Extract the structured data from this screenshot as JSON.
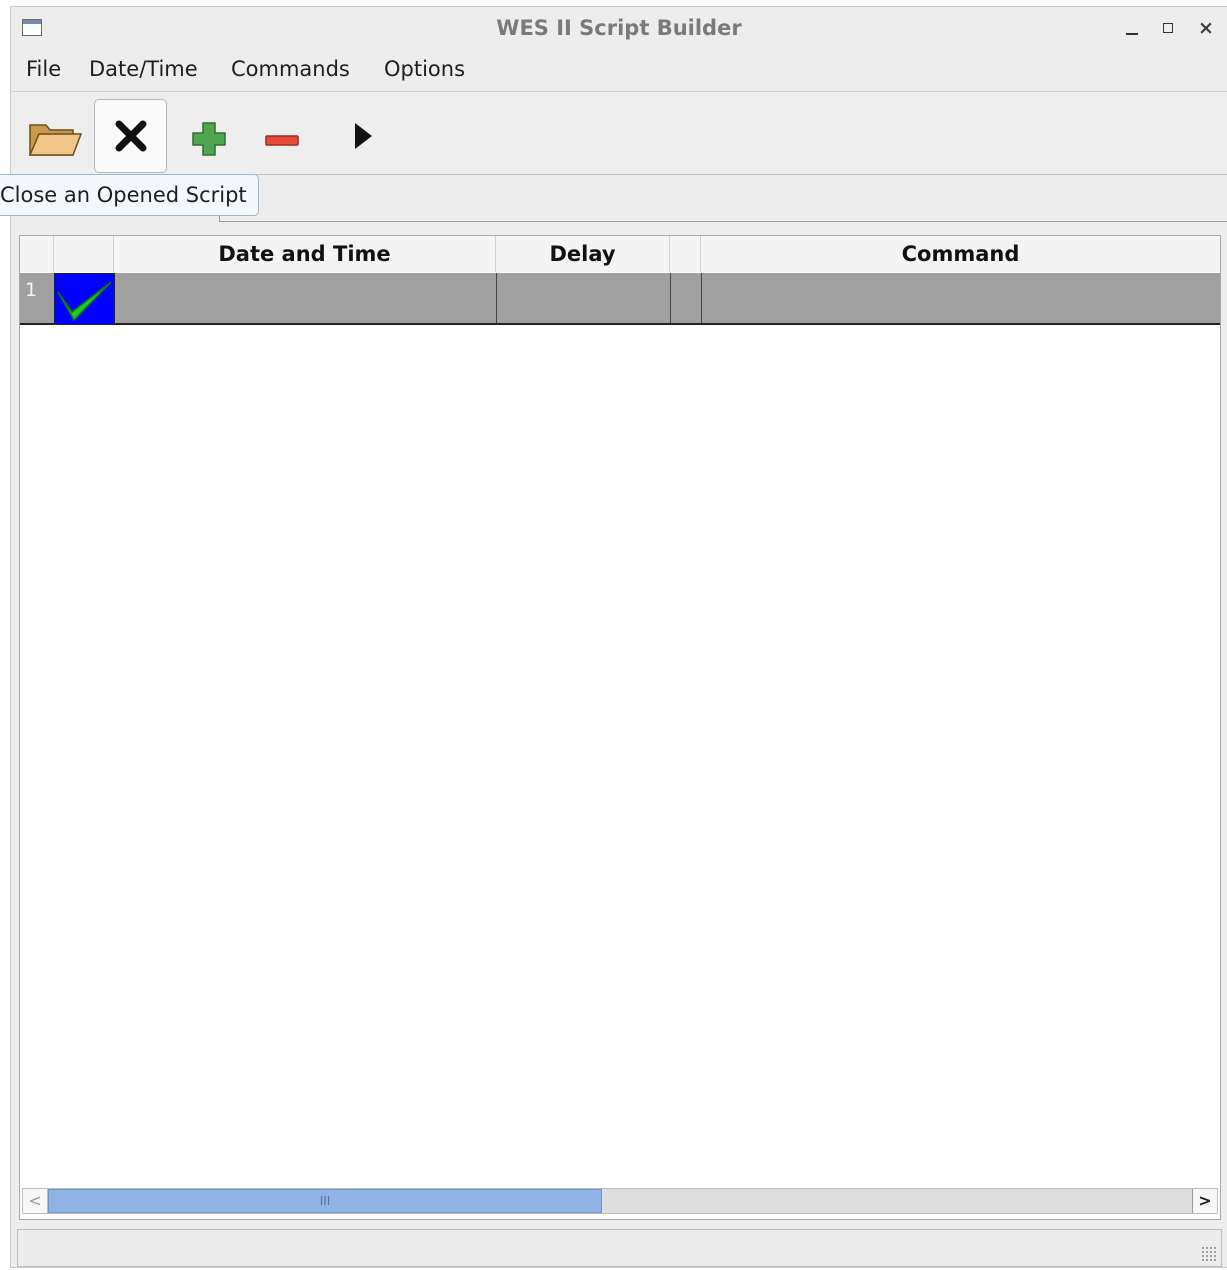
{
  "window": {
    "title": "WES II Script Builder",
    "icon": "window-icon",
    "controls": {
      "minimize": "minimize-icon",
      "maximize": "maximize-icon",
      "close": "×"
    }
  },
  "menubar": {
    "items": [
      {
        "label": "File"
      },
      {
        "label": "Date/Time"
      },
      {
        "label": "Commands"
      },
      {
        "label": "Options"
      }
    ]
  },
  "toolbar": {
    "buttons": [
      {
        "name": "open-script",
        "icon": "folder-open-icon"
      },
      {
        "name": "close-script",
        "icon": "close-x-icon",
        "state": "hovered"
      },
      {
        "name": "add-command",
        "icon": "plus-icon"
      },
      {
        "name": "remove-command",
        "icon": "minus-icon"
      },
      {
        "name": "run-script",
        "icon": "play-icon"
      }
    ],
    "tooltip": "Close an Opened Script"
  },
  "table": {
    "columns": [
      "",
      "",
      "Date and Time",
      "Delay",
      "",
      "Command"
    ],
    "rows": [
      {
        "number": "1",
        "status_icon": "check-icon",
        "date_time": "",
        "delay": "",
        "flag": "",
        "command": ""
      }
    ],
    "row_color": "#a0a0a0",
    "status_bg": "#0000ff",
    "check_color": "#22cc22"
  },
  "scrollbar": {
    "thumb_grip": "III",
    "left_arrow": "<",
    "right_arrow": ">"
  }
}
